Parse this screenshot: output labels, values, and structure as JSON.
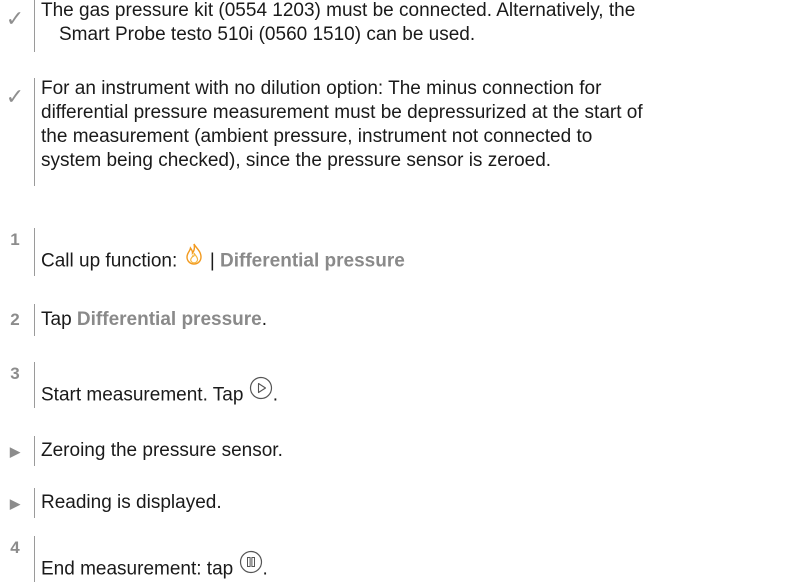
{
  "prerequisites": [
    {
      "lines": [
        "The gas pressure kit (0554 1203) must be connected. Alternatively, the",
        "Smart Probe testo 510i (0560 1510) can be used."
      ]
    },
    {
      "lines": [
        "For an instrument with no dilution option: The minus connection for",
        "differential pressure measurement must be depressurized at the start of",
        "the measurement (ambient pressure, instrument not connected to",
        "system being checked), since the pressure sensor is zeroed."
      ]
    }
  ],
  "steps": {
    "step1": {
      "number": "1",
      "prefix": "Call up function: ",
      "separator": " | ",
      "term": "Differential pressure",
      "icon": "flame-icon"
    },
    "step2": {
      "number": "2",
      "prefix": "Tap ",
      "term": "Differential pressure",
      "suffix": "."
    },
    "step3": {
      "number": "3",
      "text": "Start measurement. Tap ",
      "icon": "play-button-icon",
      "suffix": "."
    },
    "result1": {
      "text": "Zeroing the pressure sensor."
    },
    "result2": {
      "text": "Reading is displayed."
    },
    "step4": {
      "number": "4",
      "text": "End measurement: tap ",
      "icon": "pause-button-icon",
      "suffix": "."
    }
  },
  "colors": {
    "flame_outer": "#f29a1f",
    "flame_inner": "#f5b640",
    "term": "#8a8a8a",
    "marker": "#8c8c8c"
  }
}
